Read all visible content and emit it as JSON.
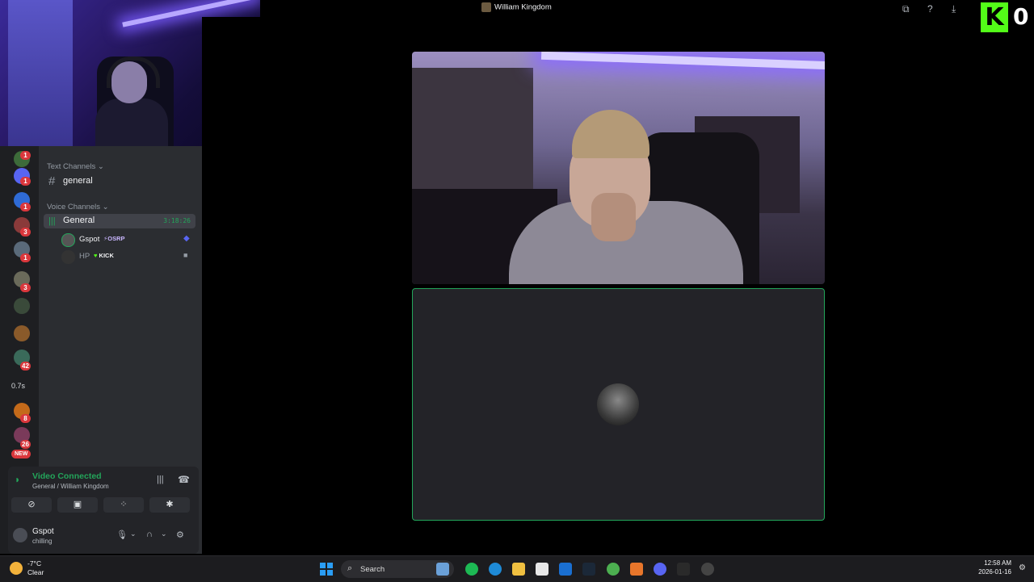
{
  "window": {
    "title": "William Kingdom"
  },
  "kick": {
    "logo": "K",
    "viewer_count": "0"
  },
  "server_rail": {
    "badges": [
      "1",
      "1",
      "1",
      "3",
      "1",
      "3",
      "42",
      "8",
      "26"
    ],
    "new_label": "NEW",
    "side_text": "0.7s"
  },
  "sidebar": {
    "text_category": "Text Channels",
    "text_channels": [
      {
        "name": "general"
      }
    ],
    "voice_category": "Voice Channels",
    "voice_channels": [
      {
        "name": "General",
        "elapsed": "3:18:26",
        "members": [
          {
            "name": "Gspot",
            "tag": "OSRP",
            "tag_color": "#c9b6ff",
            "muted": false
          },
          {
            "name": "HP",
            "tag": "KICK",
            "tag_color": "#53fc18",
            "muted": true
          }
        ]
      }
    ]
  },
  "voice_panel": {
    "status": "Video Connected",
    "location": "General / William Kingdom"
  },
  "user_panel": {
    "name": "Gspot",
    "status": "chilling"
  },
  "taskbar": {
    "weather_temp": "-7°C",
    "weather_cond": "Clear",
    "search_placeholder": "Search",
    "time": "12:58 AM",
    "date": "2026-01-16"
  },
  "colors": {
    "discord_green": "#23a55a",
    "kick_green": "#53fc18",
    "badge_red": "#da373c"
  }
}
